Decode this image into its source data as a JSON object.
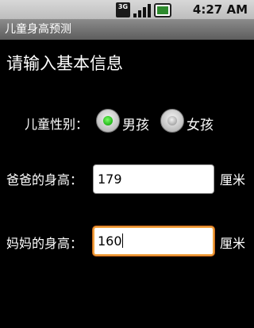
{
  "status_bar": {
    "network_label": "3G",
    "time": "4:27 AM",
    "icons": [
      "3g-icon",
      "signal-icon",
      "battery-icon"
    ]
  },
  "app": {
    "title": "儿童身高预测"
  },
  "form": {
    "heading": "请输入基本信息",
    "gender_label": "儿童性别：",
    "gender_options": [
      {
        "label": "男孩",
        "selected": true
      },
      {
        "label": "女孩",
        "selected": false
      }
    ],
    "father_label": "爸爸的身高：",
    "father_value": "179",
    "father_unit": "厘米",
    "mother_label": "妈妈的身高：",
    "mother_value": "160",
    "mother_unit": "厘米"
  },
  "colors": {
    "background": "#000000",
    "focus_border": "#f0a03c",
    "radio_selected": "#22b418"
  }
}
